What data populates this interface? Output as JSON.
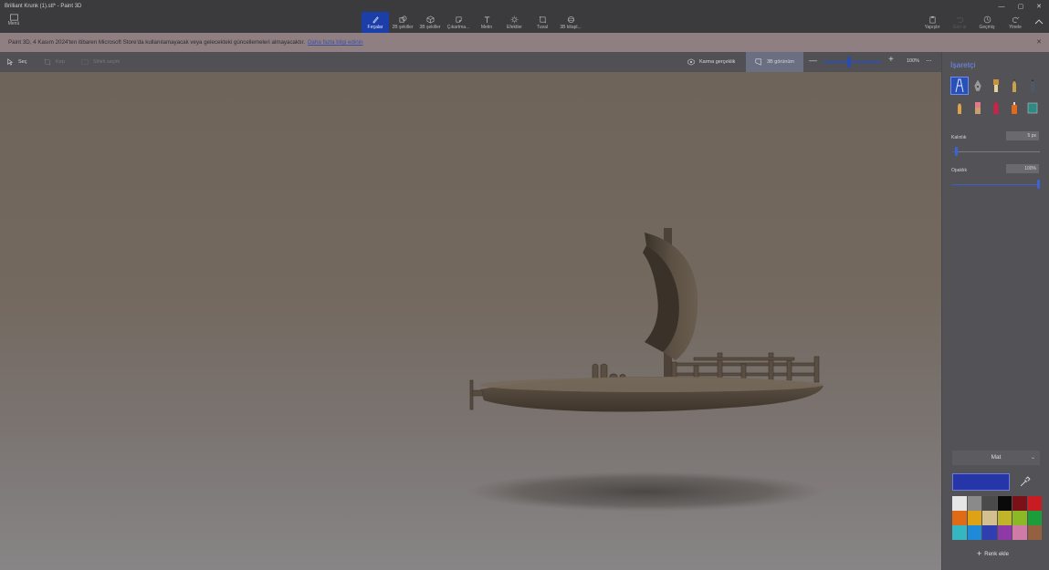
{
  "window": {
    "title": "Brilliant Krunk (1).stl* - Paint 3D",
    "minimize": "—",
    "maximize": "▢",
    "close": "✕"
  },
  "toolbar": {
    "menu_label": "Menü",
    "tabs": [
      {
        "label": "Fırçalar",
        "icon": "brush-icon"
      },
      {
        "label": "2B şekiller",
        "icon": "2d-shapes-icon"
      },
      {
        "label": "3B şekiller",
        "icon": "3d-shapes-icon"
      },
      {
        "label": "Çıkartma...",
        "icon": "stickers-icon"
      },
      {
        "label": "Metin",
        "icon": "text-icon"
      },
      {
        "label": "Efektler",
        "icon": "effects-icon"
      },
      {
        "label": "Tuval",
        "icon": "canvas-icon"
      },
      {
        "label": "3B kitapl...",
        "icon": "3d-library-icon"
      }
    ],
    "paste_label": "Yapıştır",
    "undo_label": "Geri al",
    "history_label": "Geçmiş",
    "redo_label": "Yinele"
  },
  "notification": {
    "text": "Paint 3D, 4 Kasım 2024'ten itibaren Microsoft Store'da kullanılamayacak veya gelecekteki güncellemeleri almayacaktır.",
    "link": "Daha fazla bilgi edinin",
    "close": "✕"
  },
  "subtoolbar": {
    "select_label": "Seç",
    "crop_label": "Kırp",
    "magic_select_label": "Sihirli seçim",
    "mixed_reality_label": "Karma gerçeklik",
    "view3d_label": "3B görünüm",
    "zoom_minus": "—",
    "zoom_plus": "+",
    "zoom_value": "100%",
    "zoom_level": 0.45,
    "more": "···"
  },
  "panel": {
    "title": "İşaretçi",
    "brushes": [
      "marker",
      "calligraphy-pen",
      "oil-brush",
      "watercolor",
      "pixel-pen",
      "pencil",
      "eraser",
      "crayon",
      "spray-can",
      "fill"
    ],
    "thickness_label": "Kalınlık",
    "thickness_value": "5 px",
    "thickness_level": 0.05,
    "opacity_label": "Opaklık",
    "opacity_value": "100%",
    "opacity_level": 1.0,
    "finish_label": "Mat",
    "current_color": "#2636a8",
    "swatches": [
      "#e6e6e6",
      "#8a8a8a",
      "#4a4a4a",
      "#0a0a0a",
      "#7a1018",
      "#c81b22",
      "#e06b16",
      "#e0a215",
      "#d3c090",
      "#c0b52a",
      "#8cb826",
      "#1c9c3a",
      "#36b6c0",
      "#1f8ad8",
      "#2f3fb0",
      "#8d3aa8",
      "#d07aa8",
      "#946040"
    ],
    "add_color_label": "Renk ekle"
  }
}
